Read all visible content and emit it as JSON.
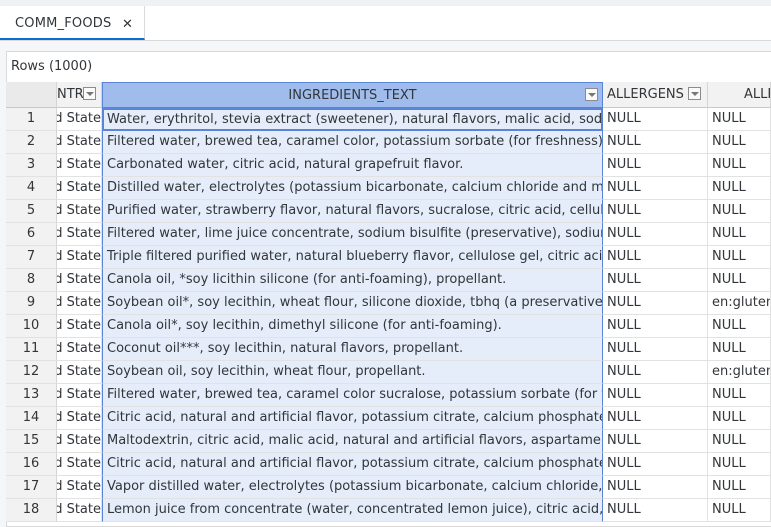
{
  "tab": {
    "title": "COMM_FOODS",
    "close_icon": "close-icon"
  },
  "rows_label": "Rows (1000)",
  "columns": [
    {
      "label": "NTR"
    },
    {
      "label": "INGREDIENTS_TEXT"
    },
    {
      "label": "ALLERGENS"
    },
    {
      "label": "ALLE"
    }
  ],
  "rows": [
    {
      "num": "1",
      "ctr": "d State",
      "ing": "Water, erythritol, stevia extract (sweetener), natural flavors, malic acid, sodium b",
      "all": "NULL",
      "all2": "NULL"
    },
    {
      "num": "2",
      "ctr": "d State",
      "ing": "Filtered water, brewed tea, caramel color, potassium sorbate (for freshness)",
      "all": "NULL",
      "all2": "NULL"
    },
    {
      "num": "3",
      "ctr": "d State",
      "ing": "Carbonated water, citric acid, natural grapefruit flavor.",
      "all": "NULL",
      "all2": "NULL"
    },
    {
      "num": "4",
      "ctr": "d State",
      "ing": "Distilled water, electrolytes (potassium bicarbonate, calcium chloride and magne",
      "all": "NULL",
      "all2": "NULL"
    },
    {
      "num": "5",
      "ctr": "d State",
      "ing": "Purified water, strawberry flavor, natural flavors, sucralose, citric acid, cellulose g",
      "all": "NULL",
      "all2": "NULL"
    },
    {
      "num": "6",
      "ctr": "d State",
      "ing": "Filtered water, lime juice concentrate, sodium bisulfite (preservative), sodium ber",
      "all": "NULL",
      "all2": "NULL"
    },
    {
      "num": "7",
      "ctr": "d State",
      "ing": "Triple filtered purified water, natural blueberry flavor, cellulose gel, citric acid, suc",
      "all": "NULL",
      "all2": "NULL"
    },
    {
      "num": "8",
      "ctr": "d State",
      "ing": "Canola oil, *soy licithin silicone (for anti-foaming), propellant.",
      "all": "NULL",
      "all2": "NULL"
    },
    {
      "num": "9",
      "ctr": "d State",
      "ing": "Soybean oil*, soy lecithin, wheat flour, silicone dioxide, tbhq (a preservative).",
      "all": "NULL",
      "all2": "en:gluten"
    },
    {
      "num": "10",
      "ctr": "d State",
      "ing": "Canola oil*, soy lecithin, dimethyl silicone (for anti-foaming).",
      "all": "NULL",
      "all2": "NULL"
    },
    {
      "num": "11",
      "ctr": "d State",
      "ing": "Coconut oil***, soy lecithin, natural flavors, propellant.",
      "all": "NULL",
      "all2": "NULL"
    },
    {
      "num": "12",
      "ctr": "d State",
      "ing": "Soybean oil, soy lecithin, wheat flour, propellant.",
      "all": "NULL",
      "all2": "en:gluten"
    },
    {
      "num": "13",
      "ctr": "d State",
      "ing": "Filtered water, brewed tea, caramel color sucralose, potassium sorbate (for fresh",
      "all": "NULL",
      "all2": "NULL"
    },
    {
      "num": "14",
      "ctr": "d State",
      "ing": "Citric acid, natural and artificial flavor, potassium citrate, calcium phosphate, asp",
      "all": "NULL",
      "all2": "NULL"
    },
    {
      "num": "15",
      "ctr": "d State",
      "ing": "Maltodextrin, citric acid, malic acid, natural and artificial flavors, aspartame,**red",
      "all": "NULL",
      "all2": "NULL"
    },
    {
      "num": "16",
      "ctr": "d State",
      "ing": "Citric acid, natural and artificial flavor, potassium citrate, calcium phosphate aspa",
      "all": "NULL",
      "all2": "NULL"
    },
    {
      "num": "17",
      "ctr": "d State",
      "ing": "Vapor distilled water, electrolytes (potassium bicarbonate, calcium chloride, mag",
      "all": "NULL",
      "all2": "NULL"
    },
    {
      "num": "18",
      "ctr": "d State",
      "ing": "Lemon juice from concentrate (water, concentrated lemon juice), citric acid, sodiu",
      "all": "NULL",
      "all2": "NULL"
    }
  ]
}
